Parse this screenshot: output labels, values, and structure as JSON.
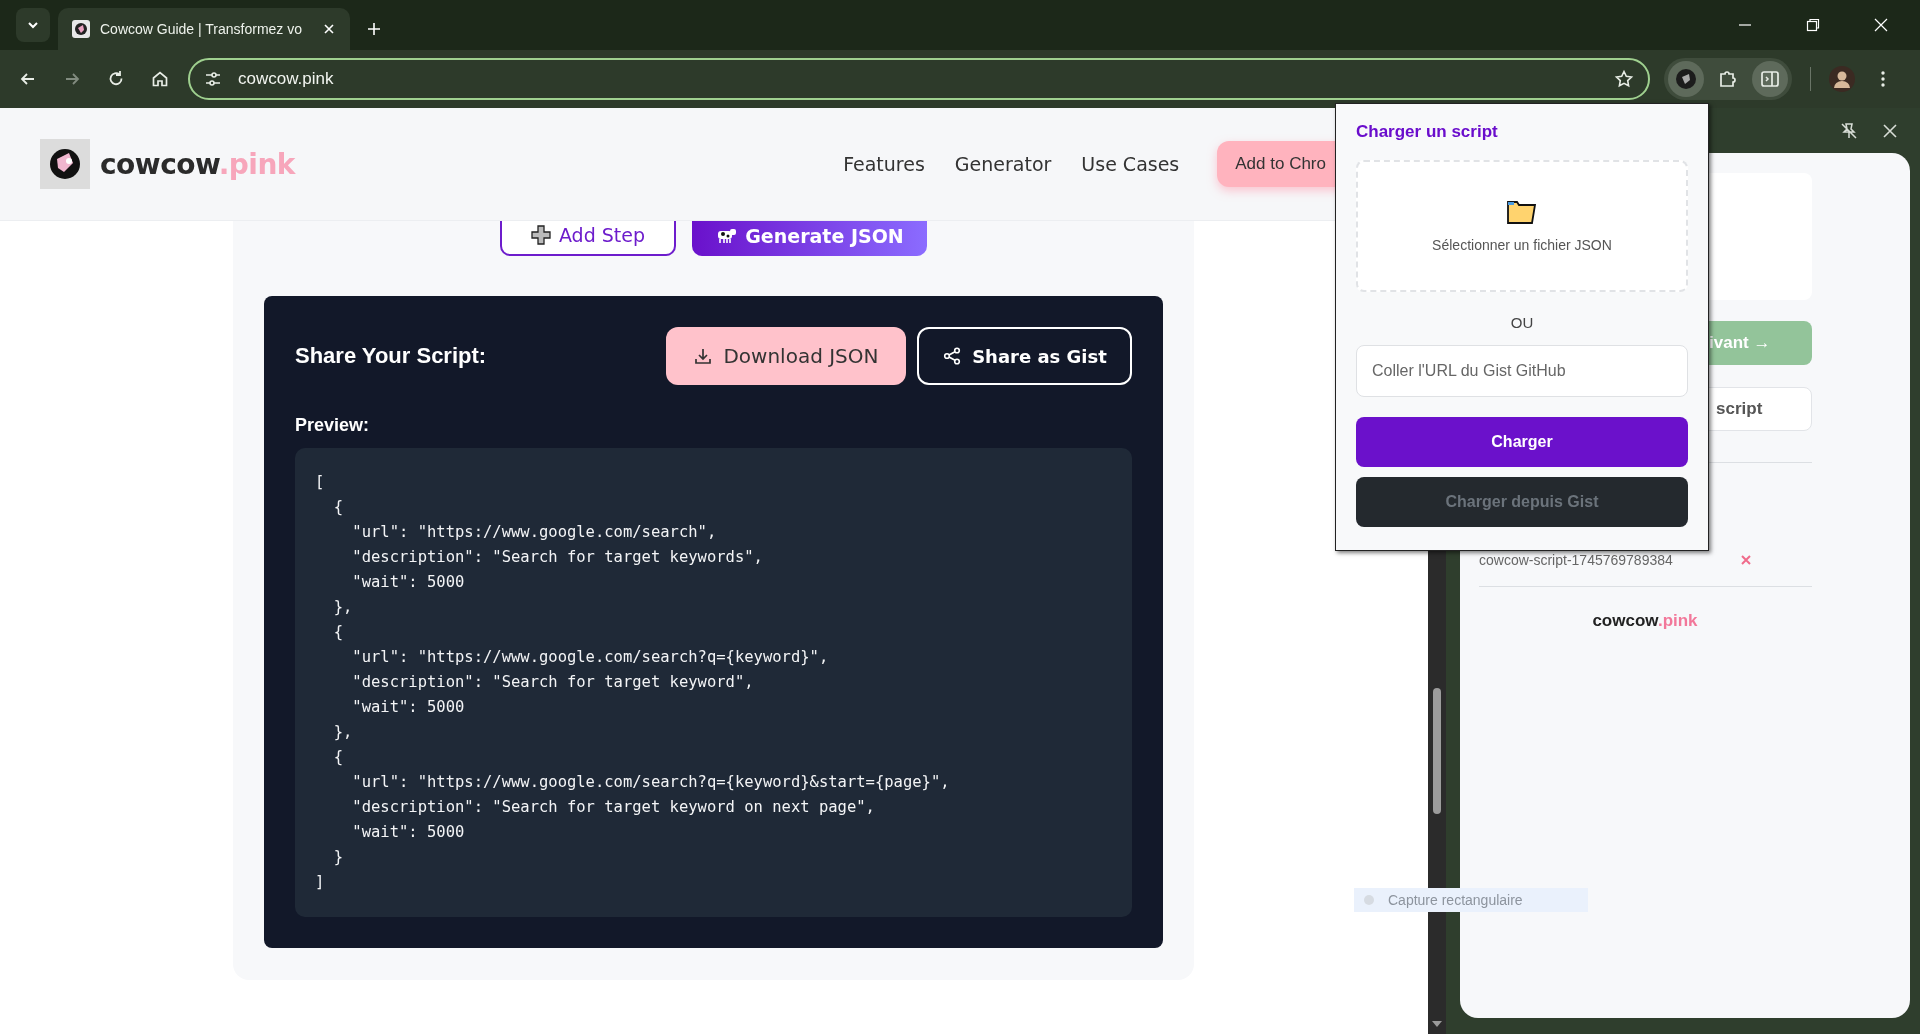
{
  "browser": {
    "tab": {
      "title": "Cowcow Guide | Transformez vo",
      "selected": true
    },
    "nav_buttons": [
      {
        "kind": "back",
        "disabled": false
      },
      {
        "kind": "forward",
        "disabled": true
      },
      {
        "kind": "reload",
        "disabled": false
      },
      {
        "kind": "home",
        "disabled": false
      }
    ],
    "address": {
      "url": "cowcow.pink"
    },
    "extensions": [
      {
        "kind": "cowcow",
        "active": true
      },
      {
        "kind": "puzzle",
        "active": false
      },
      {
        "kind": "side_panel",
        "active": true
      }
    ]
  },
  "header": {
    "logo": {
      "text": "cowcow",
      "accent": ".pink"
    },
    "nav": [
      "Features",
      "Generator",
      "Use Cases"
    ],
    "cta": "Add to Chro"
  },
  "actions": [
    {
      "kind": "add",
      "label": "Add Step"
    },
    {
      "kind": "generate",
      "label": "Generate JSON"
    }
  ],
  "share": {
    "title": "Share Your Script:",
    "buttons": [
      {
        "kind": "download",
        "label": "Download JSON"
      },
      {
        "kind": "gist",
        "label": "Share as Gist"
      }
    ],
    "preview_label": "Preview:",
    "code": [
      "[",
      "  {",
      "    \"url\": \"https://www.google.com/search\",",
      "    \"description\": \"Search for target keywords\",",
      "    \"wait\": 5000",
      "  },",
      "  {",
      "    \"url\": \"https://www.google.com/search?q={keyword}\",",
      "    \"description\": \"Search for target keyword\",",
      "    \"wait\": 5000",
      "  },",
      "  {",
      "    \"url\": \"https://www.google.com/search?q={keyword}&start={page}\",",
      "    \"description\": \"Search for target keyword on next page\",",
      "    \"wait\": 5000",
      "  }",
      "]"
    ]
  },
  "popup": {
    "title": "Charger un script",
    "file_label": "Sélectionner un fichier JSON",
    "separator": "OU",
    "url_placeholder": "Coller l'URL du Gist GitHub",
    "buttons": [
      {
        "kind": "primary",
        "label": "Charger",
        "disabled": false
      },
      {
        "kind": "dark",
        "label": "Charger depuis Gist",
        "disabled": true
      }
    ]
  },
  "side_panel": {
    "next_button": "ivant →",
    "script_button": "script",
    "saved_scripts": [
      {
        "name": "cowcow-script-1745769789384"
      }
    ],
    "footer_logo": {
      "text": "cowcow",
      "accent": ".pink"
    }
  },
  "capture_hint": "Capture rectangulaire"
}
